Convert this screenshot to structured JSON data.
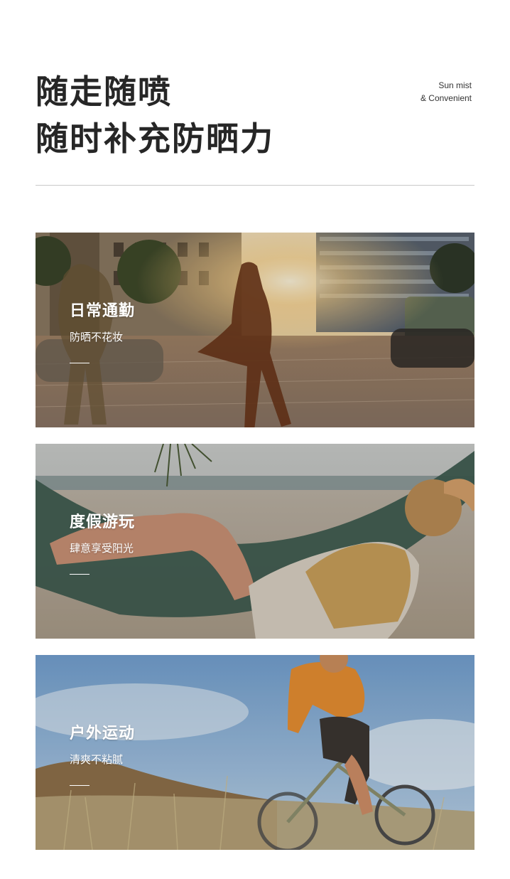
{
  "header": {
    "title_lines": [
      "随走随喷",
      "随时补充防晒力"
    ],
    "sub_lines": [
      "Sun mist",
      "& Convenient"
    ]
  },
  "cards": [
    {
      "title": "日常通勤",
      "subtitle": "防晒不花妆",
      "scene": "city-street-commute-photo"
    },
    {
      "title": "度假游玩",
      "subtitle": "肆意享受阳光",
      "scene": "beach-hammock-photo"
    },
    {
      "title": "户外运动",
      "subtitle": "清爽不粘腻",
      "scene": "cyclist-outdoor-photo"
    }
  ],
  "colors": {
    "title_text": "#262626",
    "divider": "#c8c8c8",
    "card_text": "#ffffff"
  }
}
